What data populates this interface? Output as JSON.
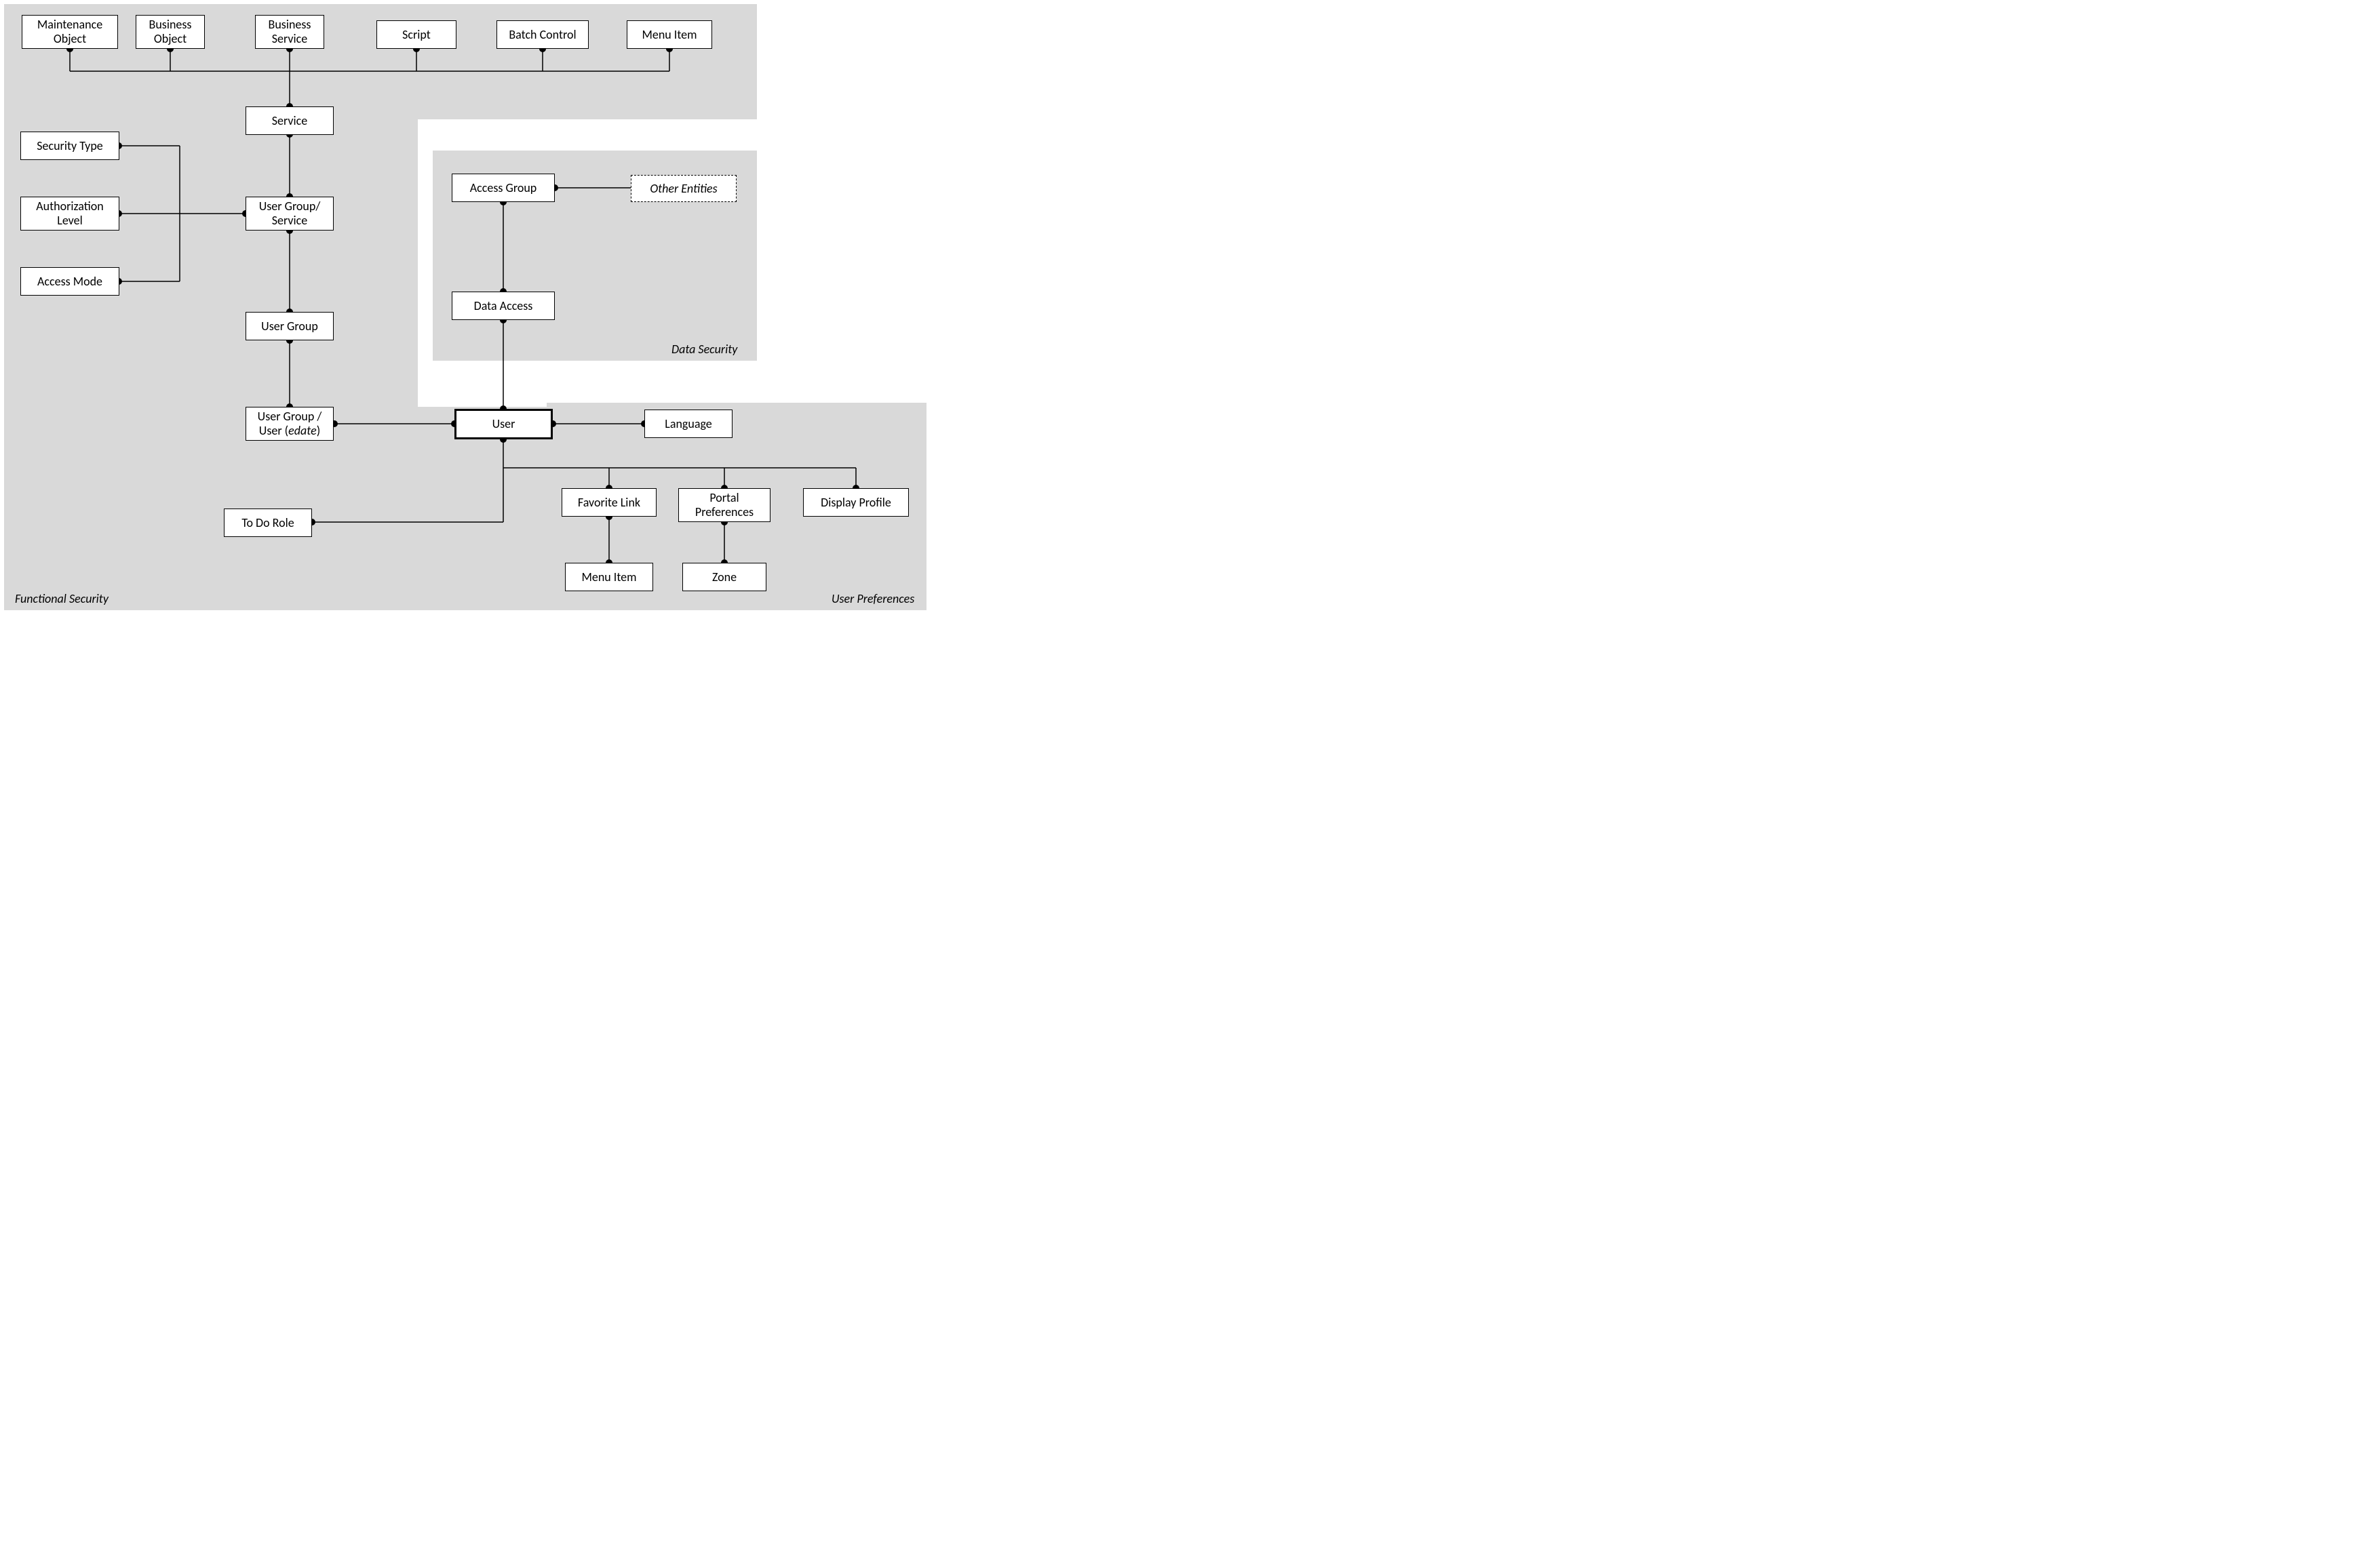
{
  "regions": {
    "functional_security": "Functional Security",
    "data_security": "Data Security",
    "user_preferences": "User Preferences"
  },
  "entities": {
    "maintenance_object": "Maintenance\nObject",
    "business_object": "Business\nObject",
    "business_service": "Business\nService",
    "script": "Script",
    "batch_control": "Batch Control",
    "menu_item_top": "Menu Item",
    "service": "Service",
    "security_type": "Security Type",
    "authorization_level": "Authorization\nLevel",
    "access_mode": "Access Mode",
    "user_group_service": "User Group/\nService",
    "user_group": "User Group",
    "user_group_user_prefix": "User Group /\nUser (",
    "user_group_user_edate": "edate",
    "user_group_user_suffix": ")",
    "to_do_role": "To Do Role",
    "access_group": "Access Group",
    "other_entities": "Other Entities",
    "data_access": "Data Access",
    "user": "User",
    "language": "Language",
    "favorite_link": "Favorite Link",
    "portal_preferences": "Portal\nPreferences",
    "display_profile": "Display Profile",
    "menu_item_bottom": "Menu Item",
    "zone": "Zone"
  }
}
